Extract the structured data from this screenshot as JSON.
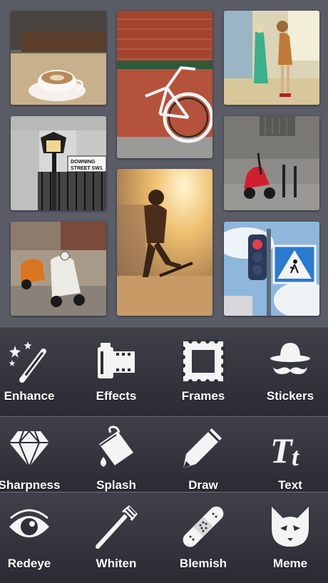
{
  "collage": {
    "photos": [
      {
        "name": "coffee-cup-photo"
      },
      {
        "name": "bicycle-brick-wall-photo"
      },
      {
        "name": "shop-window-mannequins-photo"
      },
      {
        "name": "street-lamp-sign-photo"
      },
      {
        "name": "skateboarder-sunset-photo"
      },
      {
        "name": "red-scooter-photo"
      },
      {
        "name": "vintage-scooters-photo"
      },
      {
        "name": "traffic-light-crossing-sign-photo"
      }
    ],
    "street_sign_text": [
      "DOWNING",
      "STREET SW1"
    ]
  },
  "tools": {
    "row1": [
      {
        "label": "Enhance",
        "icon": "magic-wand-icon"
      },
      {
        "label": "Effects",
        "icon": "film-canister-icon"
      },
      {
        "label": "Frames",
        "icon": "frame-icon"
      },
      {
        "label": "Stickers",
        "icon": "hat-mustache-icon"
      }
    ],
    "row2": [
      {
        "label": "Sharpness",
        "icon": "diamond-icon"
      },
      {
        "label": "Splash",
        "icon": "paint-bucket-icon"
      },
      {
        "label": "Draw",
        "icon": "pencil-icon"
      },
      {
        "label": "Text",
        "icon": "text-tt-icon"
      }
    ],
    "row3": [
      {
        "label": "Redeye",
        "icon": "eye-icon"
      },
      {
        "label": "Whiten",
        "icon": "toothbrush-icon"
      },
      {
        "label": "Blemish",
        "icon": "bandage-icon"
      },
      {
        "label": "Meme",
        "icon": "cat-face-icon"
      }
    ]
  },
  "colors": {
    "toolbar_bg": "#2f3038",
    "collage_bg": "#5a5c66",
    "label": "#ffffff"
  }
}
